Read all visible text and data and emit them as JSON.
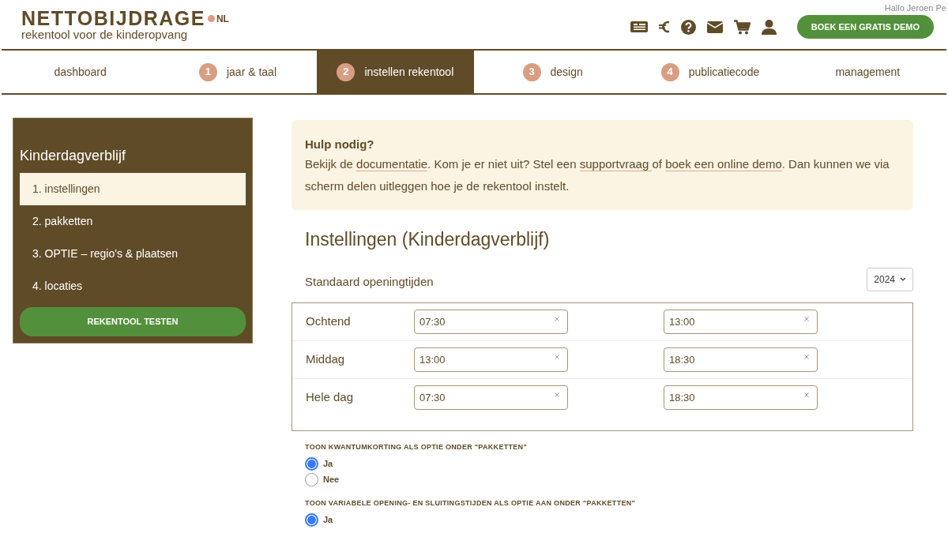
{
  "header": {
    "logo": {
      "name": "NETTOBIJDRAGE",
      "suffix": "NL",
      "tagline": "rekentool voor de kinderopvang"
    },
    "greeting": "Hallo Jeroen Pe",
    "cta": "BOEK EEN GRATIS DEMO"
  },
  "nav_tabs": [
    {
      "label": "dashboard",
      "selected": false
    },
    {
      "step": "1",
      "label": "jaar & taal",
      "selected": false
    },
    {
      "step": "2",
      "label": "instellen rekentool",
      "selected": true
    },
    {
      "step": "3",
      "label": "design",
      "selected": false
    },
    {
      "step": "4",
      "label": "publicatiecode",
      "selected": false
    },
    {
      "label": "management",
      "selected": false
    }
  ],
  "sidebar": {
    "title": "Kinderdagverblijf",
    "items": [
      {
        "label": "1. instellingen",
        "selected": true
      },
      {
        "label": "2. pakketten",
        "selected": false
      },
      {
        "label": "3. OPTIE – regio's & plaatsen",
        "selected": false
      },
      {
        "label": "4. locaties",
        "selected": false
      }
    ],
    "button": "REKENTOOL TESTEN"
  },
  "help": {
    "title": "Hulp nodig?",
    "parts": [
      {
        "kind": "text",
        "text": "Bekijk de "
      },
      {
        "kind": "link",
        "text": "documentatie"
      },
      {
        "kind": "text",
        "text": ". Kom je er niet uit? Stel een "
      },
      {
        "kind": "link",
        "text": "supportvraag "
      },
      {
        "kind": "text",
        "text": "of "
      },
      {
        "kind": "link",
        "text": "boek een online demo"
      },
      {
        "kind": "text",
        "text": ". Dan kunnen we via scherm delen uitleggen hoe je de rekentool instelt."
      }
    ]
  },
  "heading": "Instellingen (Kinderdagverblijf)",
  "schedule": {
    "label": "Standaard openingtijden",
    "year": "2024",
    "rows": [
      {
        "label": "Ochtend",
        "from": "07:30",
        "to": "13:00"
      },
      {
        "label": "Middag",
        "from": "13:00",
        "to": "18:30"
      },
      {
        "label": "Hele dag",
        "from": "07:30",
        "to": "18:30"
      }
    ]
  },
  "options": [
    {
      "question": "TOON KWANTUMKORTING ALS OPTIE ONDER \"PAKKETTEN\"",
      "choices": [
        {
          "label": "Ja",
          "selected": true
        },
        {
          "label": "Nee",
          "selected": false
        }
      ]
    },
    {
      "question": "TOON VARIABELE OPENING- EN SLUITINGSTIJDEN ALS OPTIE AAN ONDER \"PAKKETTEN\"",
      "choices": [
        {
          "label": "Ja",
          "selected": true
        }
      ]
    }
  ]
}
